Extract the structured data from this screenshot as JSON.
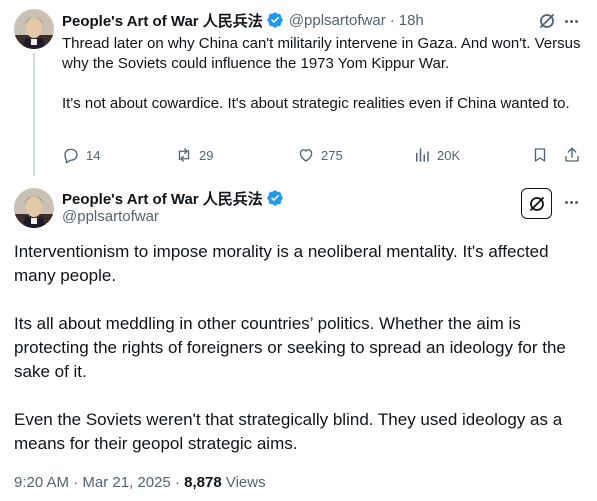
{
  "colors": {
    "text": "#0f1419",
    "secondary": "#536471",
    "verified_badge": "#1d9bf0",
    "thread_line": "#cfd9de"
  },
  "post1": {
    "author_name": "People's Art of War 人民兵法",
    "handle": "@pplsartofwar",
    "separator": "·",
    "time": "18h",
    "paragraphs": [
      "Thread later on why China can't militarily intervene in Gaza. And won't. Versus why the Soviets could influence the 1973 Yom Kippur War.",
      "It's not about cowardice. It's about strategic realities even if China wanted to."
    ],
    "actions": {
      "replies": "14",
      "reposts": "29",
      "likes": "275",
      "views": "20K"
    },
    "icons": [
      "verified-badge-icon",
      "grok-icon",
      "more-icon",
      "reply-icon",
      "repost-icon",
      "like-icon",
      "views-icon",
      "bookmark-icon",
      "share-icon"
    ]
  },
  "post2": {
    "author_name": "People's Art of War 人民兵法",
    "handle": "@pplsartofwar",
    "paragraphs": [
      "Interventionism to impose morality is a neoliberal mentality. It's affected many people.",
      "Its all about meddling in other countries’ politics. Whether the aim is protecting the rights of foreigners or seeking to spread an ideology for the sake of it.",
      "Even the Soviets weren't that strategically blind. They used ideology as a means for their geopol strategic aims."
    ],
    "meta": {
      "time": "9:20 AM",
      "sep1": "·",
      "date": "Mar 21, 2025",
      "sep2": "·",
      "views_count": "8,878",
      "views_label": "Views"
    }
  }
}
